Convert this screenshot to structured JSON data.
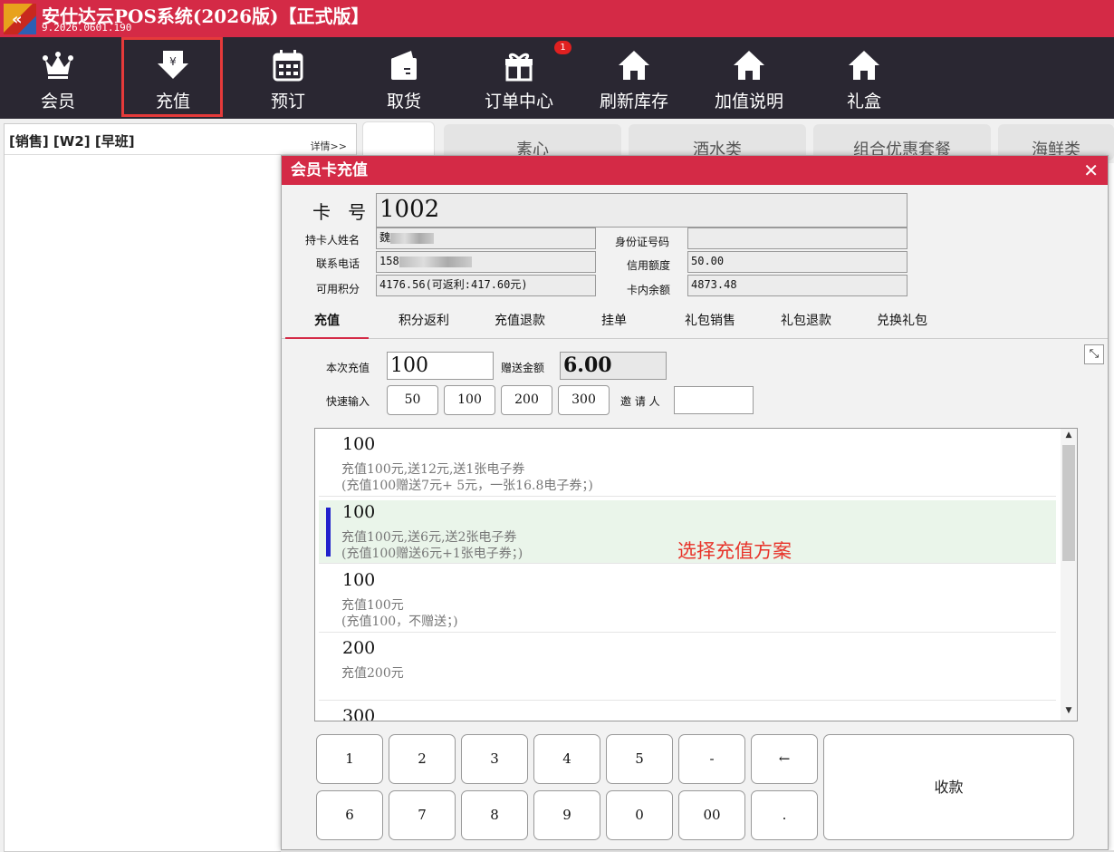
{
  "app": {
    "title": "安仕达云POS系统(2026版)【正式版】",
    "version": "9.2026.0601.190"
  },
  "toolbar": {
    "items": [
      {
        "label": "会员",
        "icon": "crown-icon"
      },
      {
        "label": "充值",
        "icon": "recharge-icon"
      },
      {
        "label": "预订",
        "icon": "calendar-icon"
      },
      {
        "label": "取货",
        "icon": "wallet-icon"
      },
      {
        "label": "订单中心",
        "icon": "gift-icon"
      },
      {
        "label": "刷新库存",
        "icon": "house-icon"
      },
      {
        "label": "加值说明",
        "icon": "house-icon"
      },
      {
        "label": "礼盒",
        "icon": "house-icon"
      }
    ],
    "order_badge": "1"
  },
  "left_panel": {
    "header": "[销售] [W2] [早班]",
    "detail_link": "详情>>"
  },
  "dialog": {
    "title": "会员卡充值",
    "card_no_label": "卡   号",
    "card_no": "1002",
    "holder_label": "持卡人姓名",
    "holder_value": "魏",
    "phone_label": "联系电话",
    "phone_value": "158",
    "points_label": "可用积分",
    "points_value": "4176.56(可返利:417.60元)",
    "idcard_label": "身份证号码",
    "idcard_value": "",
    "credit_label": "信用额度",
    "credit_value": "50.00",
    "balance_label": "卡内余额",
    "balance_value": "4873.48",
    "tabs": [
      "充值",
      "积分返利",
      "充值退款",
      "挂单",
      "礼包销售",
      "礼包退款",
      "兑换礼包"
    ],
    "recharge_label": "本次充值",
    "recharge_value": "100",
    "bonus_label": "赠送金额",
    "bonus_value": "6.00",
    "quick_label": "快速输入",
    "quick_values": [
      "50",
      "100",
      "200",
      "300"
    ],
    "inviter_label": "邀 请 人",
    "inviter_value": "",
    "hint": "选择充值方案",
    "plans": [
      {
        "amount": "100",
        "desc": "充值100元,送12元,送1张电子券",
        "note": "(充值100赠送7元+ 5元，一张16.8电子券；)"
      },
      {
        "amount": "100",
        "desc": "充值100元,送6元,送2张电子券",
        "note": "(充值100赠送6元+1张电子券；)"
      },
      {
        "amount": "100",
        "desc": "充值100元",
        "note": "(充值100，不赠送；)"
      },
      {
        "amount": "200",
        "desc": "充值200元",
        "note": ""
      },
      {
        "amount": "300",
        "desc": "",
        "note": ""
      }
    ],
    "keypad": [
      "1",
      "2",
      "3",
      "4",
      "5",
      "-",
      "←",
      "6",
      "7",
      "8",
      "9",
      "0",
      "00",
      "."
    ],
    "pay_label": "收款"
  },
  "bg_tabs": [
    "素心",
    "酒水类",
    "组合优惠套餐",
    "海鲜类"
  ],
  "colors": {
    "brand": "#d42a46",
    "toolbar": "#2a2732",
    "hint": "#e8332a",
    "selection_bar": "#2222cc"
  }
}
